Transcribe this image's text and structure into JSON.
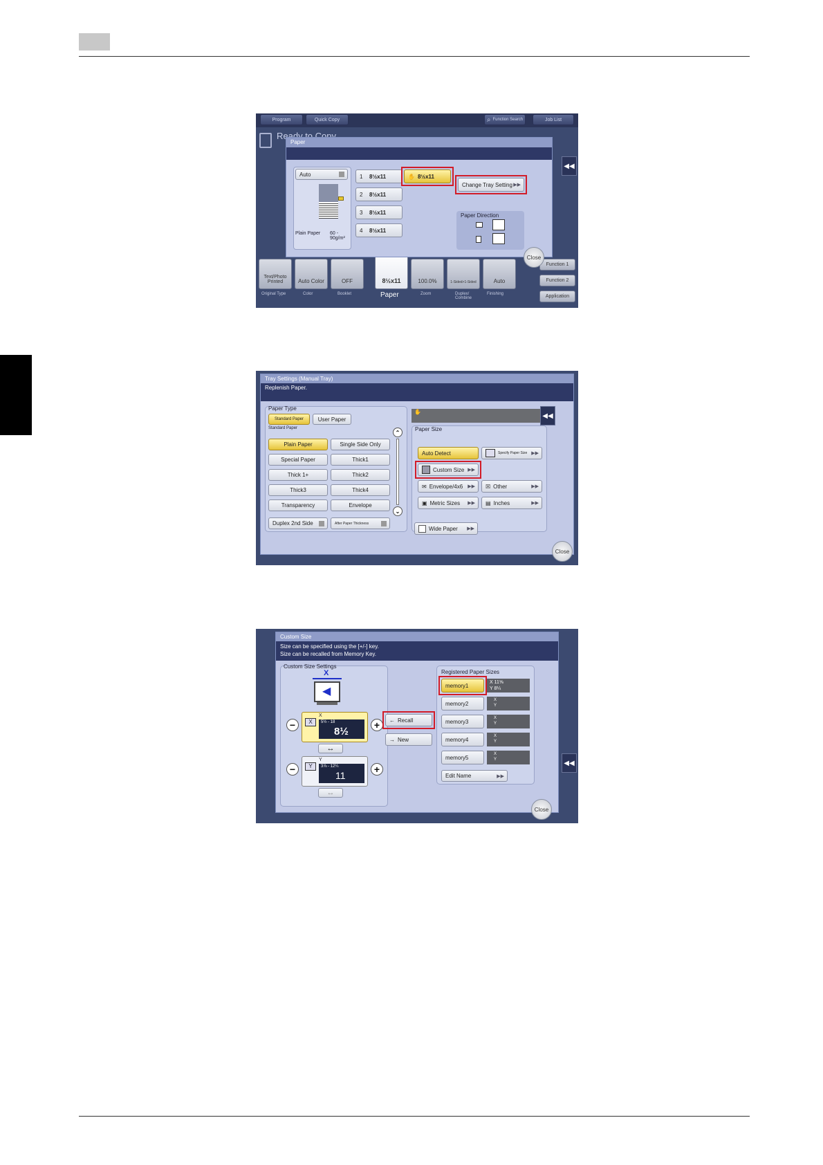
{
  "screen1": {
    "top_buttons": [
      "Program",
      "Quick Copy",
      "Function Search",
      "Job List"
    ],
    "ready_text": "Ready to Copy",
    "dialog_title": "Paper",
    "auto_label": "Auto",
    "plain_paper_label": "Plain Paper",
    "weight_label": "60 - 90g/m²",
    "trays": [
      {
        "num": "1",
        "size": "8½x11"
      },
      {
        "num": "2",
        "size": "8½x11"
      },
      {
        "num": "3",
        "size": "8½x11"
      },
      {
        "num": "4",
        "size": "8½x11"
      }
    ],
    "manual_tray_size": "8½x11",
    "change_tray_label": "Change Tray Setting",
    "paper_direction_label": "Paper Direction",
    "close_label": "Close",
    "bottom_tiles": [
      "Text/Photo Printed",
      "Auto Color",
      "OFF",
      "8½x11",
      "100.0%",
      "1-Sided>1-Sided",
      "Auto"
    ],
    "bottom_captions": [
      "Original Type",
      "Color",
      "Booklet",
      "Paper",
      "Zoom",
      "Duplex/ Combine",
      "Finishing"
    ],
    "side_buttons": [
      "Function 1",
      "Function 2",
      "Application"
    ]
  },
  "screen2": {
    "title_line1": "Tray Settings (Manual Tray)",
    "title_line2": "Replenish Paper.",
    "paper_type_label": "Paper Type",
    "tab_standard": "Standard Paper",
    "tab_user": "User Paper",
    "standard_caption": "Standard Paper",
    "types": [
      "Plain Paper",
      "Single Side Only",
      "Special Paper",
      "Thick1",
      "Thick 1+",
      "Thick2",
      "Thick3",
      "Thick4",
      "Transparency",
      "Envelope"
    ],
    "duplex_label": "Duplex 2nd Side",
    "after_label": "After Paper Thickness",
    "paper_size_label": "Paper Size",
    "auto_detect": "Auto Detect",
    "specify_size": "Specify Paper Size",
    "custom_size": "Custom Size",
    "envelope": "Envelope/4x6",
    "other": "Other",
    "metric": "Metric Sizes",
    "inches": "Inches",
    "wide_paper": "Wide Paper",
    "close_label": "Close"
  },
  "screen3": {
    "title": "Custom Size",
    "info_line1": "Size can be specified using the [+/-] key.",
    "info_line2": "Size can be recalled from Memory Key.",
    "settings_label": "Custom Size Settings",
    "x_letter": "X",
    "x_range": "5½ - 18",
    "x_value": "8½",
    "y_letter": "Y",
    "y_range": "3⅞ - 12¼",
    "y_value": "11",
    "recall_label": "Recall",
    "new_label": "New",
    "registered_label": "Registered Paper Sizes",
    "memories": [
      {
        "name": "memory1",
        "x": "X 11⅝",
        "y": "Y 8¼"
      },
      {
        "name": "memory2",
        "x": "X",
        "y": "Y"
      },
      {
        "name": "memory3",
        "x": "X",
        "y": "Y"
      },
      {
        "name": "memory4",
        "x": "X",
        "y": "Y"
      },
      {
        "name": "memory5",
        "x": "X",
        "y": "Y"
      }
    ],
    "edit_name_label": "Edit Name",
    "close_label": "Close"
  }
}
